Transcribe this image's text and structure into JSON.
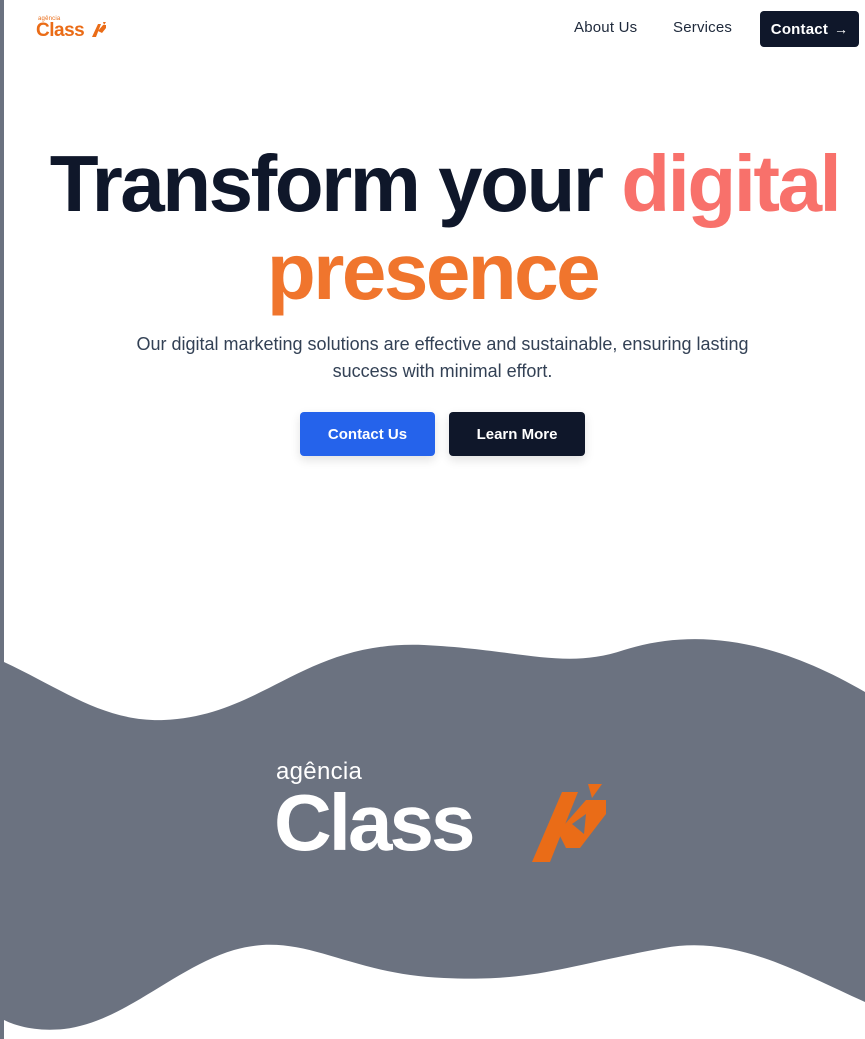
{
  "brand": {
    "sub": "agência",
    "name": "Class",
    "accent_color": "#ea6c17"
  },
  "nav": {
    "items": [
      {
        "label": "About Us"
      },
      {
        "label": "Services"
      }
    ],
    "contact_label": "Contact",
    "contact_icon": "arrow-right-icon"
  },
  "hero": {
    "title_part1": "Transform your ",
    "title_highlight1": "digital",
    "title_highlight2": "presence",
    "subtitle": "Our digital marketing solutions are effective and sustainable, ensuring lasting success with minimal effort.",
    "primary_button": "Contact Us",
    "secondary_button": "Learn More"
  },
  "colors": {
    "primary_button": "#2563eb",
    "dark": "#0f172a",
    "highlight_coral": "#f8716b",
    "highlight_orange": "#f0752d",
    "wave": "#6b7280"
  }
}
